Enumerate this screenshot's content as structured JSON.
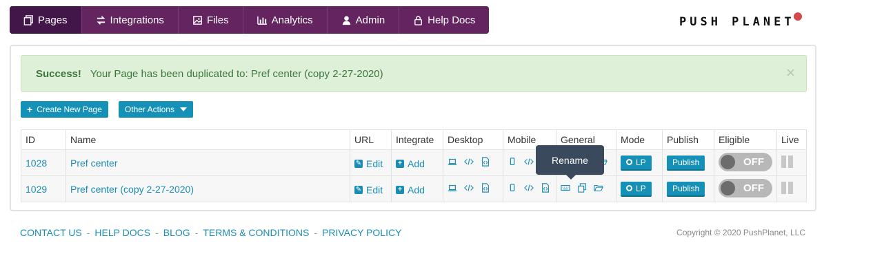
{
  "nav": {
    "items": [
      {
        "label": "Pages",
        "icon": "pages-icon"
      },
      {
        "label": "Integrations",
        "icon": "integrations-icon"
      },
      {
        "label": "Files",
        "icon": "files-icon"
      },
      {
        "label": "Analytics",
        "icon": "analytics-icon"
      },
      {
        "label": "Admin",
        "icon": "admin-icon"
      },
      {
        "label": "Help Docs",
        "icon": "lock-icon"
      }
    ],
    "active_index": 0
  },
  "logo": {
    "text": "PUSH PLANET"
  },
  "alert": {
    "bold": "Success!",
    "message": "Your Page has been duplicated to: Pref center (copy 2-27-2020)",
    "close": "×"
  },
  "buttons": {
    "create": "Create New Page",
    "other": "Other Actions"
  },
  "table": {
    "headers": [
      "ID",
      "Name",
      "URL",
      "Integrate",
      "Desktop",
      "Mobile",
      "General",
      "Mode",
      "Publish",
      "Eligible",
      "Live"
    ],
    "rows": [
      {
        "id": "1028",
        "name": "Pref center",
        "url": "Edit",
        "integrate": "Add",
        "mode": "LP",
        "publish": "Publish",
        "eligible": "OFF"
      },
      {
        "id": "1029",
        "name": "Pref center (copy 2-27-2020)",
        "url": "Edit",
        "integrate": "Add",
        "mode": "LP",
        "publish": "Publish",
        "eligible": "OFF"
      }
    ]
  },
  "tooltip": {
    "text": "Rename"
  },
  "footer": {
    "links": [
      "CONTACT US",
      "HELP DOCS",
      "BLOG",
      "TERMS & CONDITIONS",
      "PRIVACY POLICY"
    ],
    "separator": "-",
    "copyright": "Copyright © 2020 PushPlanet, LLC"
  },
  "colors": {
    "nav_bg": "#5c1f5e",
    "accent": "#1591b8",
    "success_bg": "#dff0d8",
    "tooltip_bg": "#3a4a5c"
  }
}
